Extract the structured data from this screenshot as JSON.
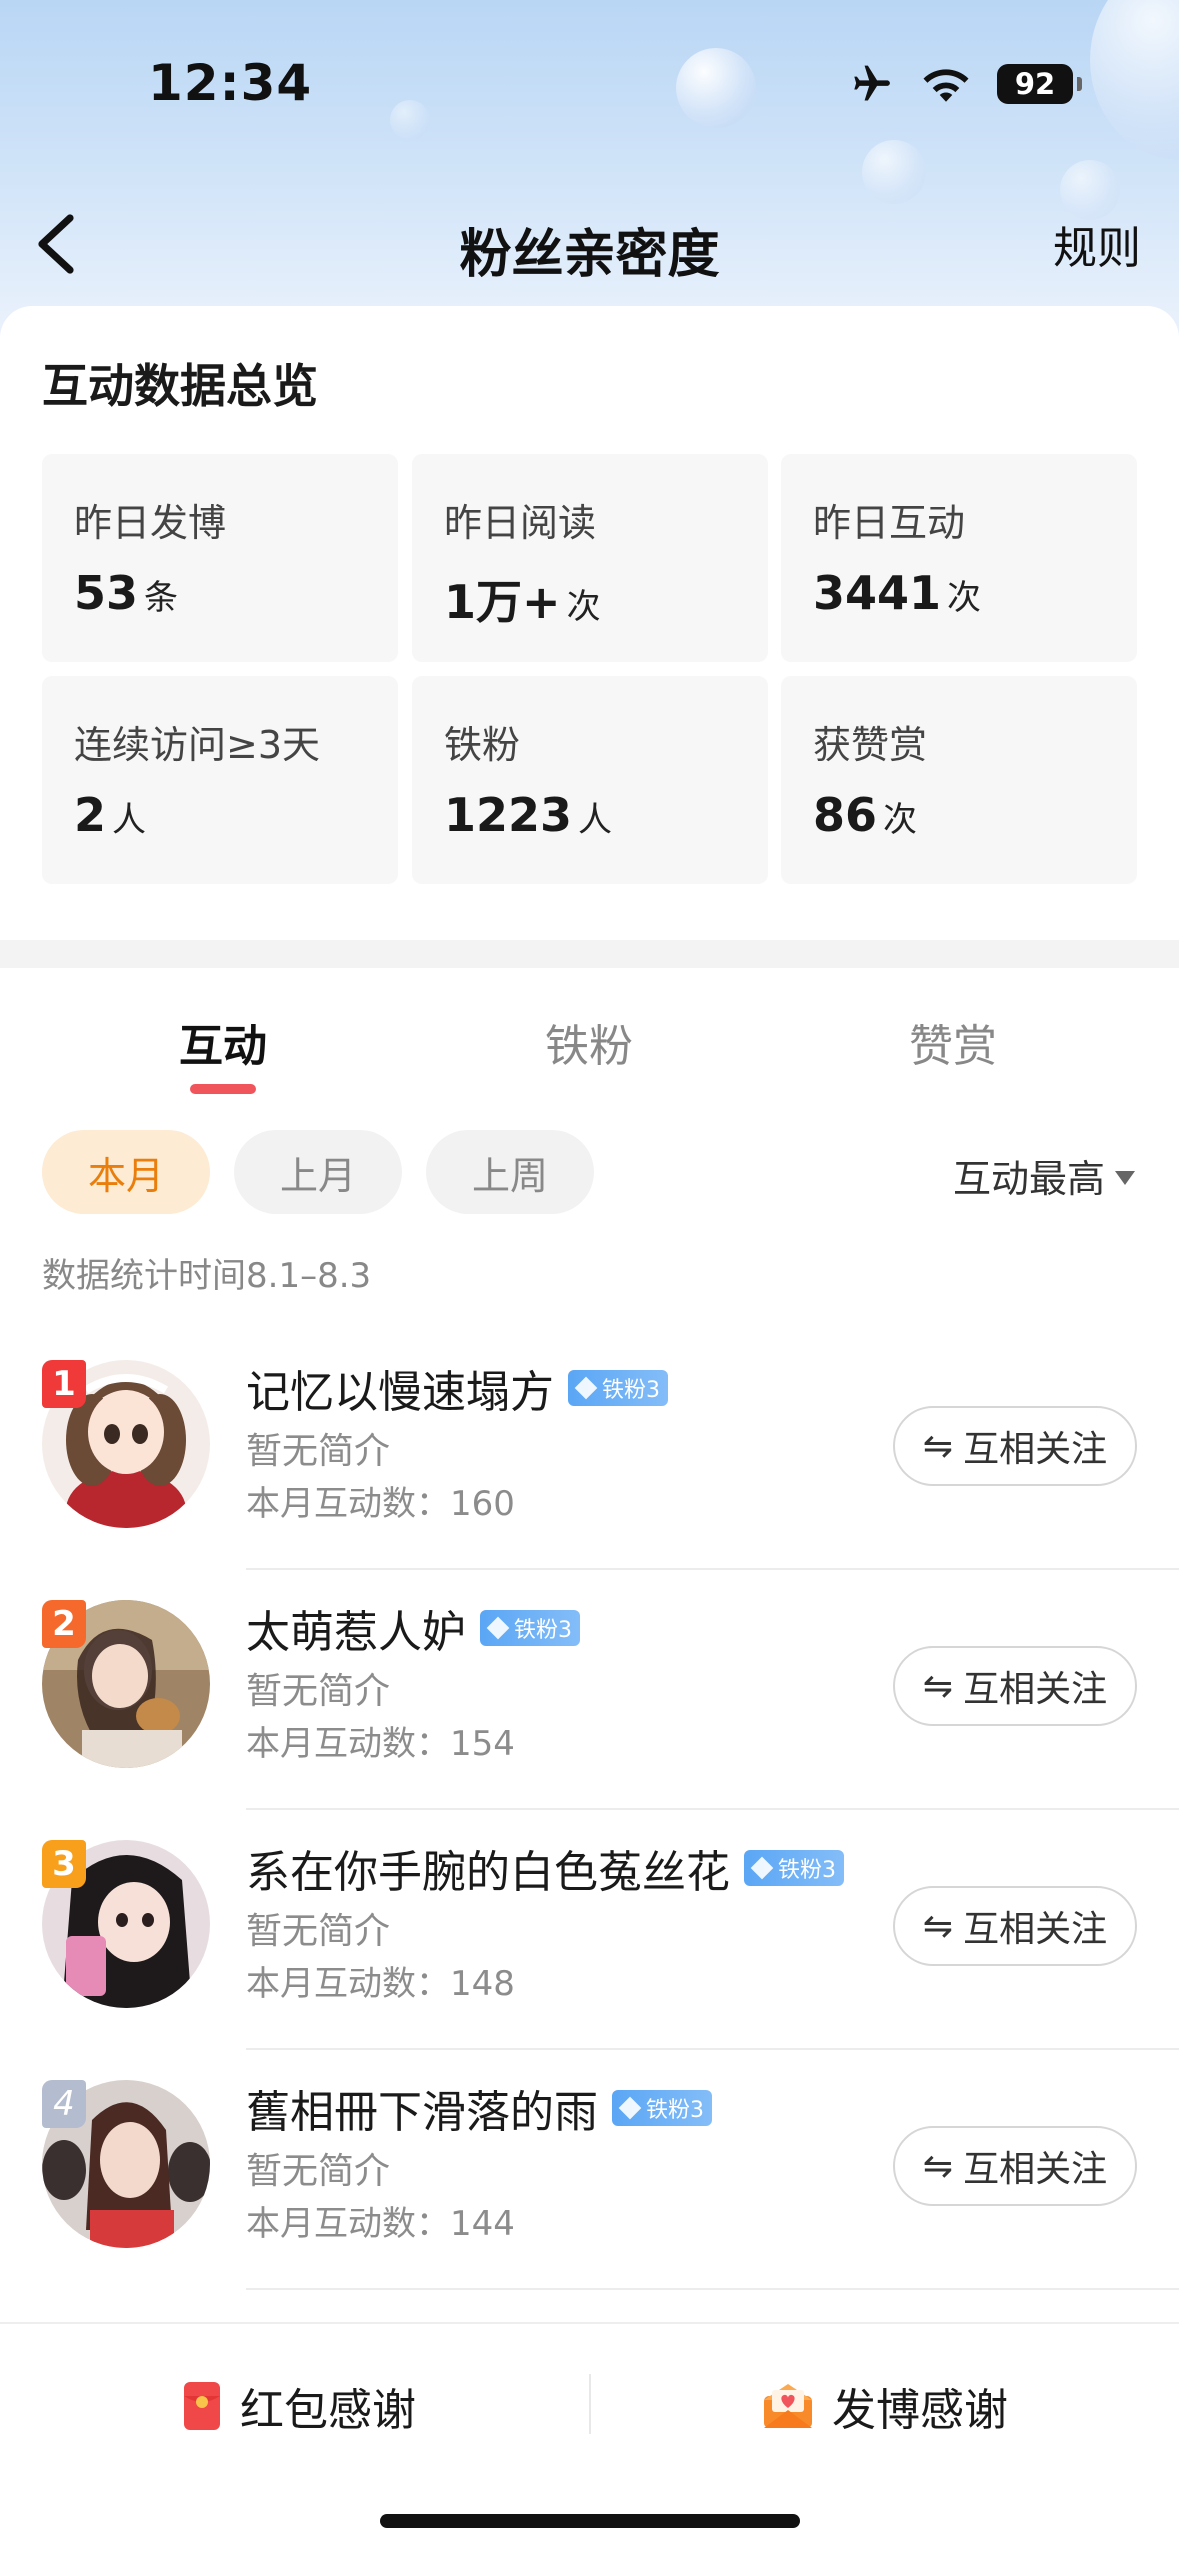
{
  "status_bar": {
    "time": "12:34",
    "battery": "92"
  },
  "nav": {
    "title": "粉丝亲密度",
    "rules": "规则"
  },
  "overview": {
    "title": "互动数据总览",
    "stats": [
      {
        "label": "昨日发博",
        "value": "53",
        "unit": "条"
      },
      {
        "label": "昨日阅读",
        "value": "1万+",
        "unit": "次"
      },
      {
        "label": "昨日互动",
        "value": "3441",
        "unit": "次"
      },
      {
        "label": "连续访问≥3天",
        "value": "2",
        "unit": "人"
      },
      {
        "label": "铁粉",
        "value": "1223",
        "unit": "人"
      },
      {
        "label": "获赞赏",
        "value": "86",
        "unit": "次"
      }
    ]
  },
  "tabs": [
    "互动",
    "铁粉",
    "赞赏"
  ],
  "filters": [
    "本月",
    "上月",
    "上周"
  ],
  "sort_label": "互动最高",
  "date_range": "数据统计时间8.1–8.3",
  "fans": [
    {
      "rank": "1",
      "name": "记忆以慢速塌方",
      "badge": "铁粉3",
      "bio": "暂无简介",
      "count": "本月互动数：160",
      "button": "互相关注"
    },
    {
      "rank": "2",
      "name": "太萌惹人妒",
      "badge": "铁粉3",
      "bio": "暂无简介",
      "count": "本月互动数：154",
      "button": "互相关注"
    },
    {
      "rank": "3",
      "name": "系在你手腕的白色菟丝花",
      "badge": "铁粉3",
      "bio": "暂无简介",
      "count": "本月互动数：148",
      "button": "互相关注"
    },
    {
      "rank": "4",
      "name": "舊相冊下滑落的雨",
      "badge": "铁粉3",
      "bio": "暂无简介",
      "count": "本月互动数：144",
      "button": "互相关注"
    }
  ],
  "bottom": {
    "red_packet": "红包感谢",
    "post_thanks": "发博感谢"
  },
  "colors": {
    "accent_red": "#f0555c",
    "pill_active_bg": "#fdebd3",
    "pill_active_text": "#ea7e0c",
    "badge_blue": "#5aa6f5"
  }
}
